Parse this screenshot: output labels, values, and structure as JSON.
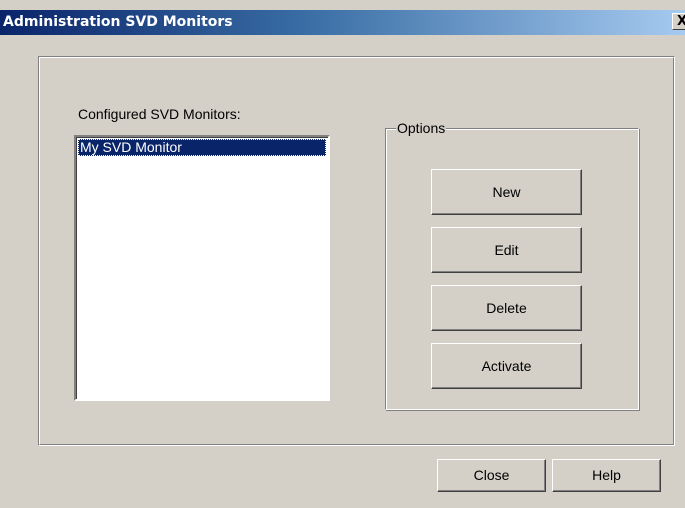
{
  "window": {
    "title": "Administration SVD Monitors",
    "close_glyph": "X"
  },
  "monitors": {
    "label": "Configured SVD Monitors:",
    "items": [
      {
        "label": "My SVD Monitor",
        "selected": true
      }
    ]
  },
  "options": {
    "label": "Options",
    "buttons": {
      "new": "New",
      "edit": "Edit",
      "delete": "Delete",
      "activate": "Activate"
    }
  },
  "footer": {
    "close": "Close",
    "help": "Help"
  },
  "colors": {
    "face": "#d4d0c8",
    "selection": "#0a246a",
    "title_gradient_start": "#0a246a",
    "title_gradient_end": "#a6caf0"
  }
}
